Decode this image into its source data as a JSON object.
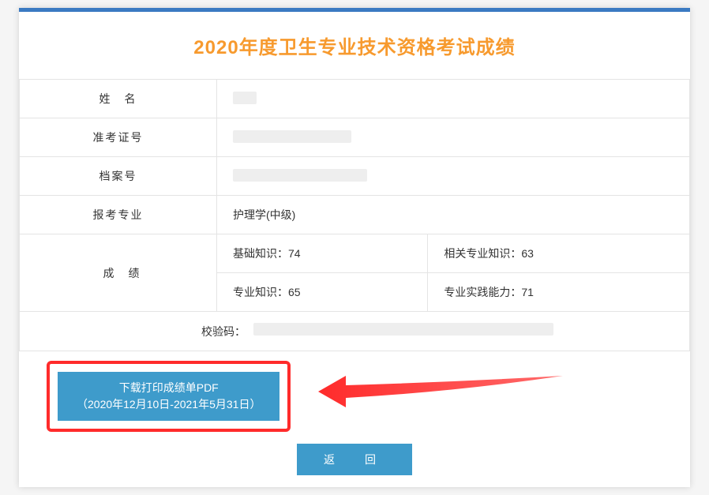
{
  "title": "2020年度卫生专业技术资格考试成绩",
  "rows": {
    "name": {
      "label": "姓　名",
      "value": ""
    },
    "ticket": {
      "label": "准考证号",
      "value": ""
    },
    "file": {
      "label": "档案号",
      "value": ""
    },
    "major": {
      "label": "报考专业",
      "value": "护理学(中级)"
    },
    "score": {
      "label": "成　绩",
      "items": {
        "basic": {
          "label": "基础知识：",
          "value": "74"
        },
        "related": {
          "label": "相关专业知识：",
          "value": "63"
        },
        "pro": {
          "label": "专业知识：",
          "value": "65"
        },
        "practice": {
          "label": "专业实践能力：",
          "value": "71"
        }
      }
    },
    "checksum": {
      "label": "校验码：",
      "value": ""
    }
  },
  "buttons": {
    "download": {
      "line1": "下载打印成绩单PDF",
      "line2": "（2020年12月10日-2021年5月31日）"
    },
    "return": "返　回"
  }
}
